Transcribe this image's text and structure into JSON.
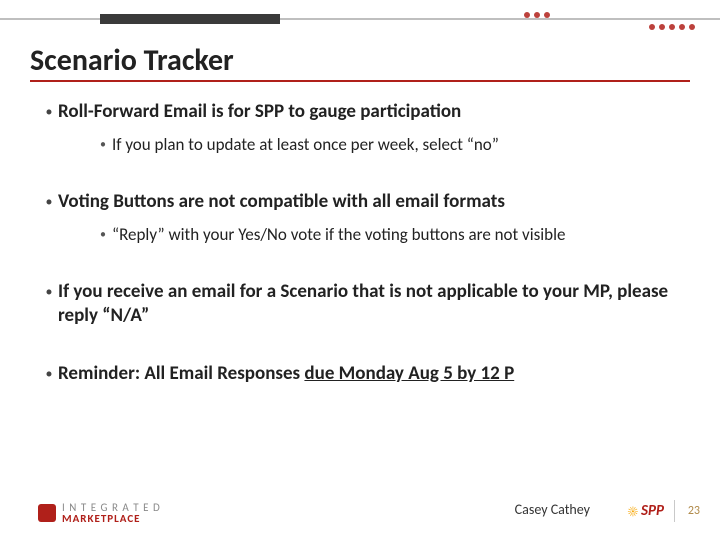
{
  "title": "Scenario Tracker",
  "bullets": {
    "b1": {
      "text": "Roll-Forward Email is for SPP to gauge participation",
      "sub": "If you plan to update  at least once per week, select “no”"
    },
    "b2": {
      "text": "Voting Buttons are not compatible with all email formats",
      "sub": "“Reply” with your Yes/No vote if the voting buttons are not visible"
    },
    "b3": {
      "text": "If you receive an email for a Scenario that is not applicable to your MP, please reply “N/A”"
    },
    "b4": {
      "pre": "Reminder: All Email Responses ",
      "u": "due Monday Aug 5 by 12 P"
    }
  },
  "footer": {
    "logo_line1": "I N T E G R A T E D",
    "logo_line2": "MARKETPLACE",
    "presenter": "Casey Cathey",
    "spp": "SPP",
    "page": "23"
  },
  "colors": {
    "accent": "#b0201a",
    "grey": "#bfbfbf"
  }
}
